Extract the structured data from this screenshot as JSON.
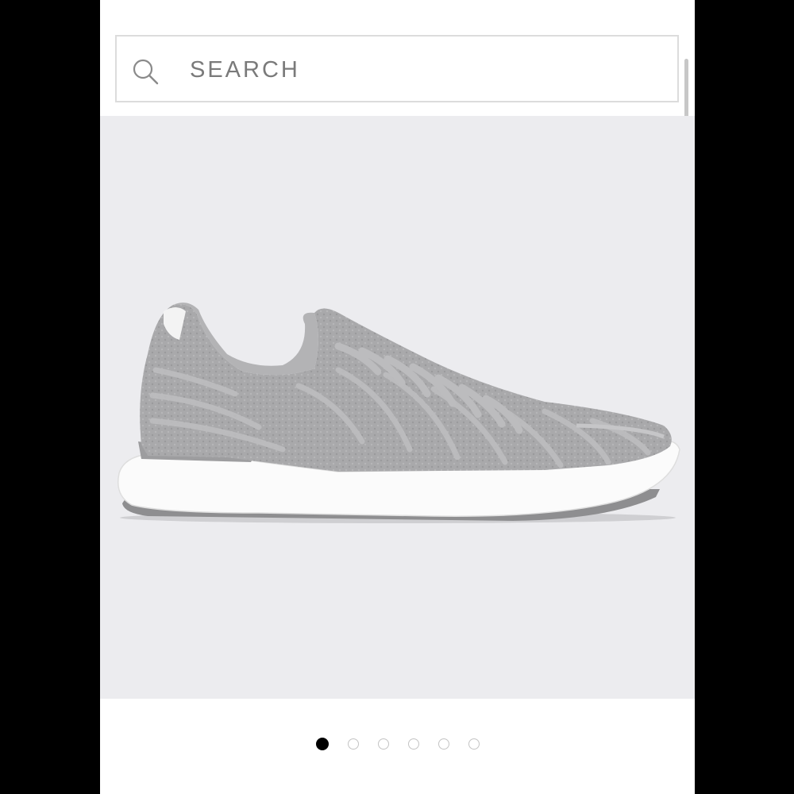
{
  "search": {
    "placeholder": "SEARCH",
    "value": ""
  },
  "icons": {
    "search": "search-icon"
  },
  "product": {
    "image_icon": "sneaker-image",
    "background_color": "#ececef"
  },
  "carousel": {
    "total": 6,
    "active_index": 0
  },
  "colors": {
    "frame": "#000000",
    "active_dot": "#000000",
    "inactive_dot_border": "#c4c4c4",
    "search_text": "#7a7a7a"
  }
}
